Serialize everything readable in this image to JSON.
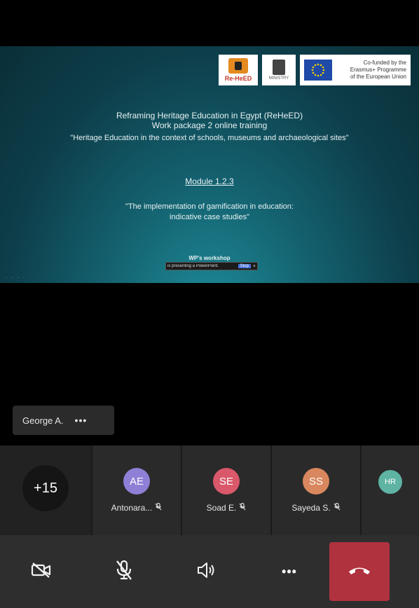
{
  "slide": {
    "logos": {
      "logo1_text": "Re-HeED",
      "logo2_text": "MINISTRY",
      "eu_text_1": "Co-funded by the",
      "eu_text_2": "Erasmus+ Programme",
      "eu_text_3": "of the European Union"
    },
    "title_line1": "Reframing Heritage Education in Egypt (ReHeED)",
    "title_line2": "Work package 2 online training",
    "title_line3": "\"Heritage Education in the context of schools, museums and archaeological sites\"",
    "module": "Module 1.2.3",
    "quote_line1": "\"The implementation of gamification in education:",
    "quote_line2": "indicative case studies\"",
    "footer_text": "WP's workshop",
    "share_bar_text": "is presenting a PowerPoint.",
    "share_bar_button": "Stop",
    "share_bar_close": "×",
    "nav_dots": "· · · ·"
  },
  "presenter": {
    "name": "George A.",
    "more_label": "•••"
  },
  "participants": {
    "more_count": "+15",
    "people": [
      {
        "initials": "AE",
        "name": "Antonara...",
        "color": "#8f7fd6"
      },
      {
        "initials": "SE",
        "name": "Soad E.",
        "color": "#d9586a"
      },
      {
        "initials": "SS",
        "name": "Sayeda S.",
        "color": "#d9875e"
      },
      {
        "initials": "HR",
        "name": "",
        "color": "#5fb3a3"
      }
    ],
    "mic_off_glyph": "🎙"
  },
  "controls": {
    "more_label": "•••"
  }
}
